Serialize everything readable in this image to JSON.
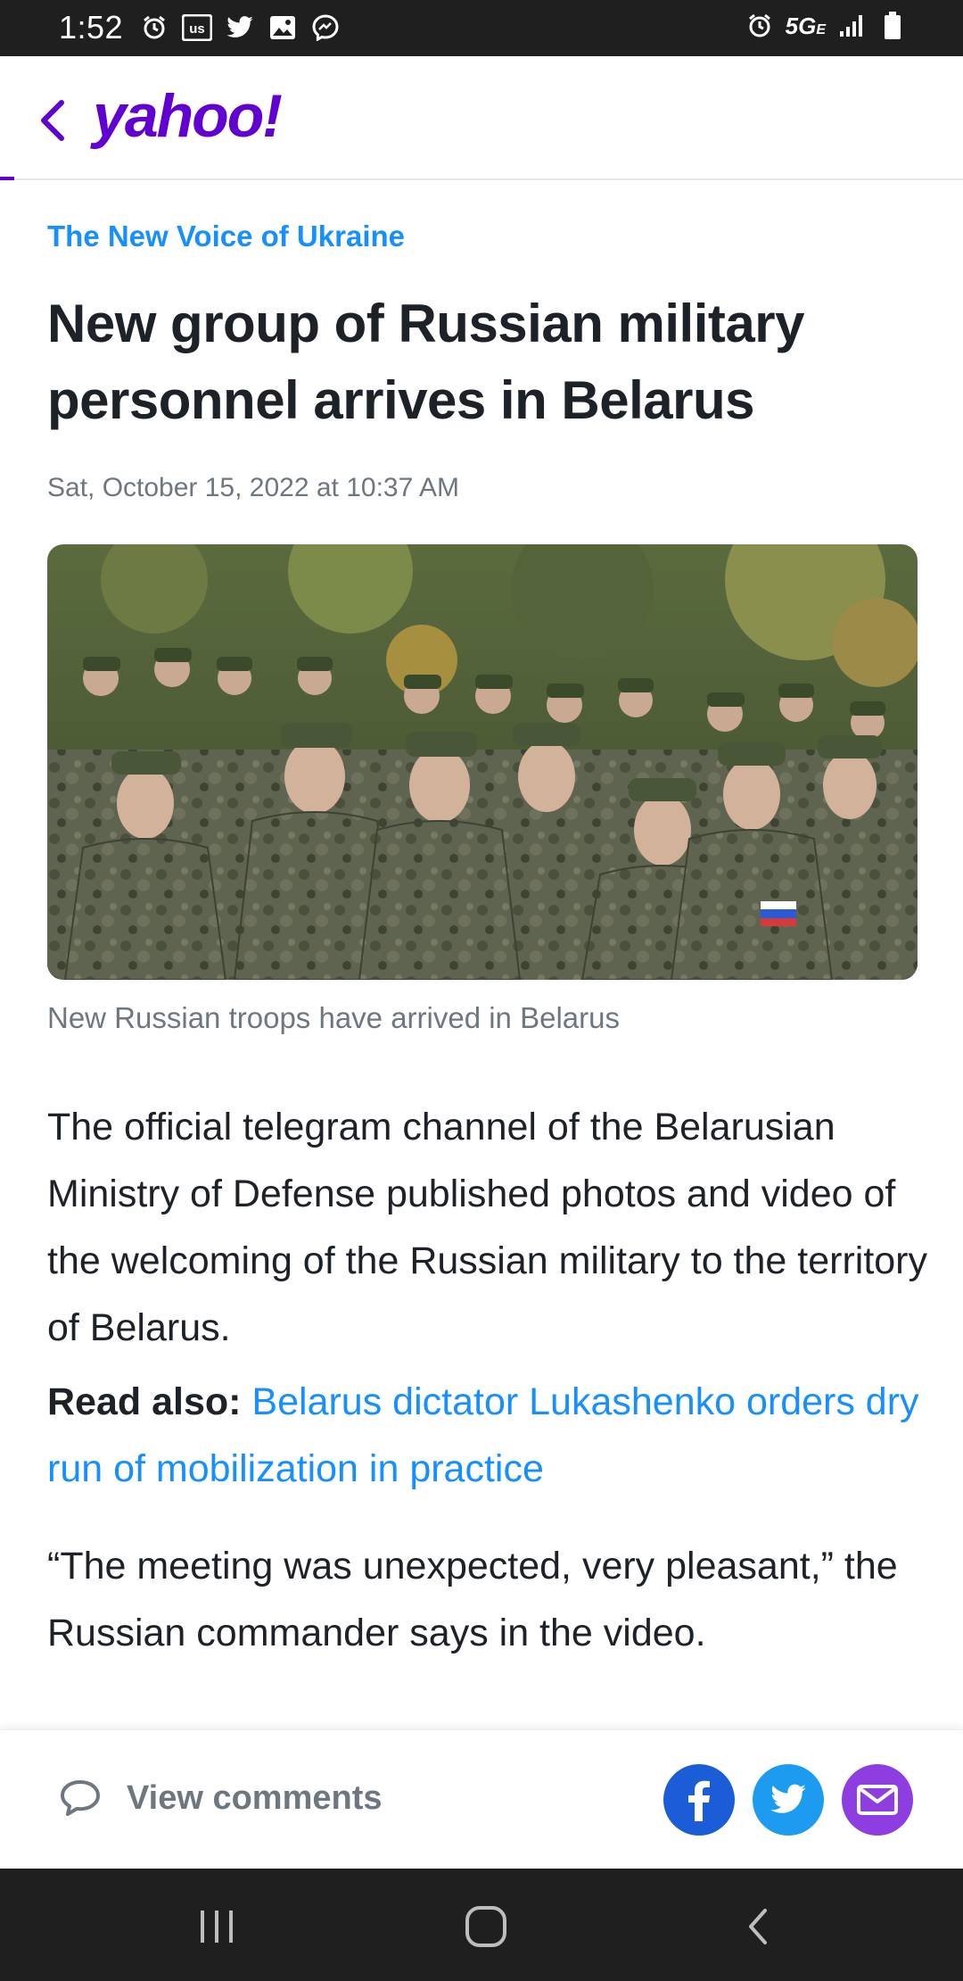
{
  "status_bar": {
    "time": "1:52",
    "network": "5G",
    "network_sub": "E",
    "left_icons": [
      "alarm-icon",
      "us-app-icon",
      "twitter-icon",
      "gallery-icon",
      "messenger-icon"
    ],
    "right_icons": [
      "alarm-icon",
      "signal-icon",
      "battery-icon"
    ]
  },
  "header": {
    "logo": "yahoo!",
    "brand_color": "#6001d2"
  },
  "article": {
    "publisher": "The New Voice of Ukraine",
    "headline": "New group of Russian military personnel arrives in Belarus",
    "date": "Sat, October 15, 2022 at 10:37 AM",
    "image_caption": "New Russian troops have arrived in Belarus",
    "paragraph1": "The official telegram channel of the Belarusian Ministry of Defense published photos and video of the welcoming of the Russian military to the territory of Belarus.",
    "read_also_label": "Read also:",
    "read_also_link": "Belarus dictator Lukashenko orders dry run of mobilization in practice",
    "paragraph3": "“The meeting was unexpected, very pleasant,” the Russian commander says in the video.",
    "link_color": "#188fff"
  },
  "footer": {
    "comments_label": "View comments",
    "share": [
      {
        "name": "facebook-share-button",
        "color": "#1a5dd6"
      },
      {
        "name": "twitter-share-button",
        "color": "#1d9bf0"
      },
      {
        "name": "email-share-button",
        "color": "#8e3ee0"
      }
    ]
  }
}
